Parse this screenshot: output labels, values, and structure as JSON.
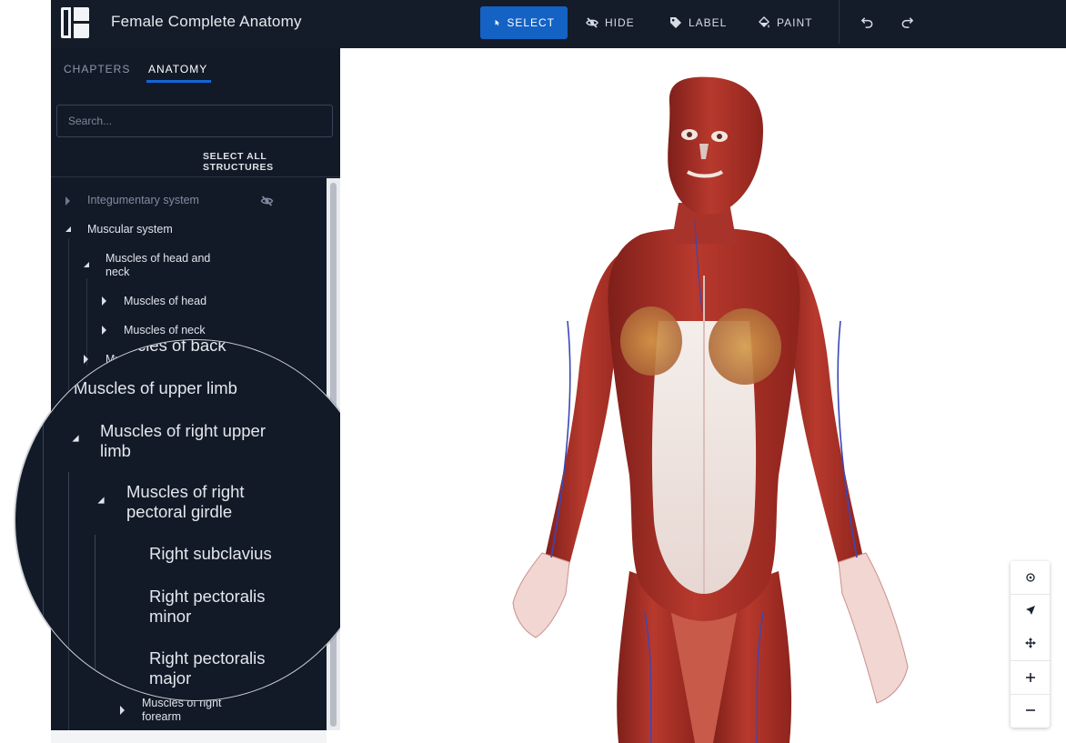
{
  "app": {
    "title": "Female Complete Anatomy"
  },
  "toolbar": {
    "tools": [
      {
        "label": "SELECT",
        "icon": "cursor-icon",
        "active": true
      },
      {
        "label": "HIDE",
        "icon": "eye-off-icon",
        "active": false
      },
      {
        "label": "LABEL",
        "icon": "tag-icon",
        "active": false
      },
      {
        "label": "PAINT",
        "icon": "paint-bucket-icon",
        "active": false
      }
    ],
    "undo_icon": "undo-icon",
    "redo_icon": "redo-icon",
    "accent": "#1462c4"
  },
  "sidebar": {
    "tabs": [
      {
        "label": "CHAPTERS",
        "active": false
      },
      {
        "label": "ANATOMY",
        "active": true
      }
    ],
    "search": {
      "placeholder": "Search...",
      "value": ""
    },
    "select_all_label": "SELECT ALL STRUCTURES",
    "tree": [
      {
        "label": "Integumentary system",
        "expanded": false,
        "hidden": true
      },
      {
        "label": "Muscular system",
        "expanded": true
      },
      {
        "label": "Muscles of head and neck",
        "expanded": true
      },
      {
        "label": "Muscles of head",
        "expanded": false
      },
      {
        "label": "Muscles of neck",
        "expanded": false
      },
      {
        "label": "Muscles of back",
        "expanded": false
      },
      {
        "label": "Muscles of right forearm",
        "expanded": false
      }
    ]
  },
  "magnifier": {
    "rows": [
      {
        "label": "Muscles of back"
      },
      {
        "label": "Muscles of upper limb"
      },
      {
        "label": "Muscles of right upper limb",
        "expanded": true
      },
      {
        "label": "Muscles of right pectoral girdle",
        "expanded": true
      },
      {
        "label": "Right subclavius"
      },
      {
        "label": "Right pectoralis minor"
      },
      {
        "label": "Right pectoralis major"
      }
    ]
  },
  "viewer": {
    "model": "female-muscular-figure",
    "nav_controls": [
      "target-icon",
      "navigate-icon",
      "move-icon",
      "zoom-in-icon",
      "zoom-out-icon"
    ]
  }
}
